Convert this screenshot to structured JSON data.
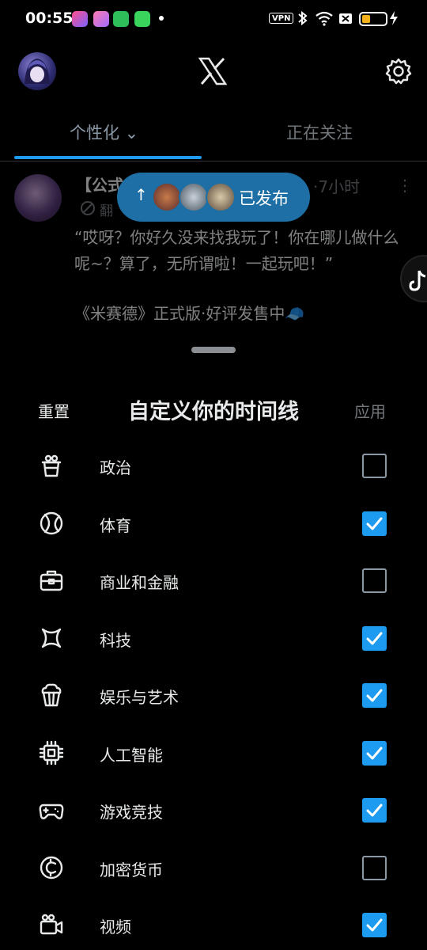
{
  "status_bar": {
    "time": "00:55",
    "vpn_label": "VPN",
    "battery_level": 0.35,
    "app_icons": [
      "scissors-app-icon",
      "flower-app-icon",
      "shield-app-icon",
      "phone-app-icon"
    ]
  },
  "header": {
    "logo": "x-logo-icon",
    "settings_icon": "gear-icon"
  },
  "tabs": [
    {
      "label": "个性化 ⌄",
      "active": true
    },
    {
      "label": "正在关注",
      "active": false
    }
  ],
  "tweet": {
    "name": "【公式",
    "time": "·7小时",
    "translate": "翻",
    "text": "“哎呀？你好久没来找我玩了！你在哪儿做什么呢~？算了，无所谓啦！一起玩吧！”",
    "text2": "《米赛德》正式版·好评发售中🧢"
  },
  "posted_pill": {
    "arrow": "↑",
    "label": "已发布"
  },
  "sheet": {
    "reset_label": "重置",
    "title": "自定义你的时间线",
    "apply_label": "应用",
    "topics": [
      {
        "label": "政治",
        "icon": "podium-icon",
        "checked": false
      },
      {
        "label": "体育",
        "icon": "tennis-ball-icon",
        "checked": true
      },
      {
        "label": "商业和金融",
        "icon": "briefcase-icon",
        "checked": false
      },
      {
        "label": "科技",
        "icon": "tech-x-icon",
        "checked": true
      },
      {
        "label": "娱乐与艺术",
        "icon": "popcorn-icon",
        "checked": true
      },
      {
        "label": "人工智能",
        "icon": "chip-icon",
        "checked": true
      },
      {
        "label": "游戏竞技",
        "icon": "gamepad-icon",
        "checked": true
      },
      {
        "label": "加密货币",
        "icon": "crypto-coin-icon",
        "checked": false
      },
      {
        "label": "视频",
        "icon": "video-camera-icon",
        "checked": true
      }
    ]
  }
}
